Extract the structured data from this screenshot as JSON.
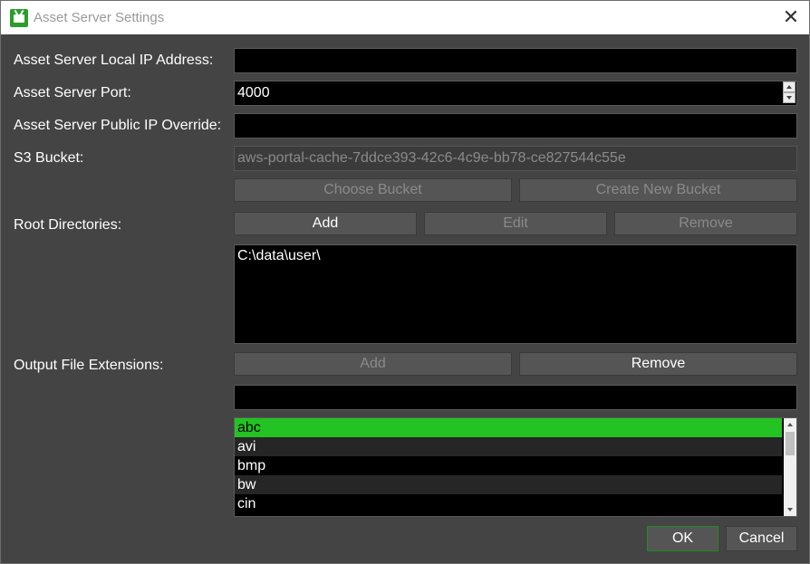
{
  "window": {
    "title": "Asset Server Settings",
    "icon": "tv-icon",
    "close_icon": "close-icon",
    "accent_color": "#22c322"
  },
  "fields": {
    "local_ip": {
      "label": "Asset Server Local IP Address:",
      "value": ""
    },
    "port": {
      "label": "Asset Server Port:",
      "value": "4000"
    },
    "public_ip": {
      "label": "Asset Server Public IP Override:",
      "value": ""
    },
    "s3_bucket": {
      "label": "S3 Bucket:",
      "value": "aws-portal-cache-7ddce393-42c6-4c9e-bb78-ce827544c55e"
    }
  },
  "bucket_buttons": {
    "choose": "Choose Bucket",
    "create": "Create New Bucket"
  },
  "root_directories": {
    "label": "Root Directories:",
    "add": "Add",
    "edit": "Edit",
    "remove": "Remove",
    "items": [
      "C:\\data\\user\\"
    ]
  },
  "output_extensions": {
    "label": "Output File Extensions:",
    "add": "Add",
    "remove": "Remove",
    "input_value": "",
    "items": [
      "abc",
      "avi",
      "bmp",
      "bw",
      "cin"
    ],
    "selected": "abc"
  },
  "footer": {
    "ok": "OK",
    "cancel": "Cancel"
  }
}
